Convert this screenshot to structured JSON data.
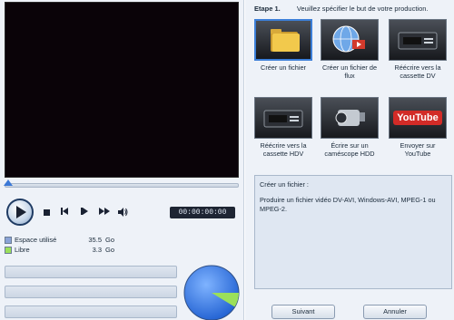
{
  "player": {
    "timecode": "00:00:00:00"
  },
  "space": {
    "used_label": "Espace utilisé",
    "used_value": "35.5",
    "used_unit": "Go",
    "used_color": "#8aa3d6",
    "free_label": "Libre",
    "free_value": "3.3",
    "free_unit": "Go",
    "free_color": "#9be05a"
  },
  "step": {
    "label": "Etape 1.",
    "instruction": "Veuillez spécifier le but de votre production."
  },
  "tiles": [
    {
      "label": "Créer un fichier",
      "icon": "folder-icon"
    },
    {
      "label": "Créer un fichier de flux",
      "icon": "globe-stream-icon"
    },
    {
      "label": "Réécrire vers la cassette DV",
      "icon": "dv-deck-icon"
    },
    {
      "label": "Réécrire vers la cassette HDV",
      "icon": "hdv-deck-icon"
    },
    {
      "label": "Écrire sur un caméscope HDD",
      "icon": "camcorder-icon"
    },
    {
      "label": "Envoyer sur YouTube",
      "icon": "youtube-icon",
      "logo": "YouTube"
    }
  ],
  "description": {
    "title": "Créer un fichier :",
    "body": "Produire un fichier vidéo DV-AVI, Windows-AVI, MPEG-1 ou MPEG-2."
  },
  "buttons": {
    "next": "Suivant",
    "cancel": "Annuler"
  }
}
